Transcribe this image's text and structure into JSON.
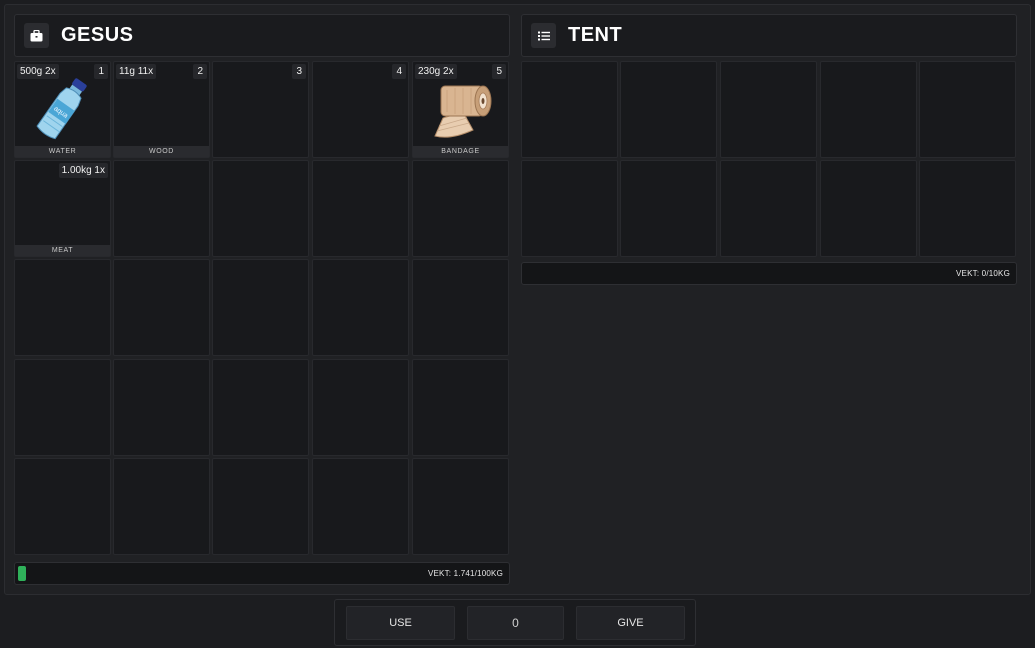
{
  "player": {
    "title": "GESUS",
    "icon": "briefcase-icon",
    "weight_label": "VEKT: 1.741/100KG",
    "weight_fraction": 0.01741
  },
  "container": {
    "title": "TENT",
    "icon": "list-icon",
    "weight_label": "VEKT: 0/10KG",
    "weight_fraction": 0
  },
  "items": {
    "water": {
      "weight": "500g 2x",
      "slot": "1",
      "label": "WATER",
      "icon": "water-bottle-icon"
    },
    "wood": {
      "weight": "11g 11x",
      "slot": "2",
      "label": "WOOD"
    },
    "slot3": {
      "slot": "3"
    },
    "slot4": {
      "slot": "4"
    },
    "bandage": {
      "weight": "230g 2x",
      "slot": "5",
      "label": "BANDAGE",
      "icon": "bandage-roll-icon"
    },
    "meat": {
      "weight": "1.00kg 1x",
      "label": "MEAT"
    }
  },
  "actions": {
    "use_label": "USE",
    "amount_value": "0",
    "give_label": "GIVE"
  },
  "colors": {
    "background": "#1c1d20",
    "slot": "#18191c",
    "weight_fill": "#2fb15a"
  }
}
